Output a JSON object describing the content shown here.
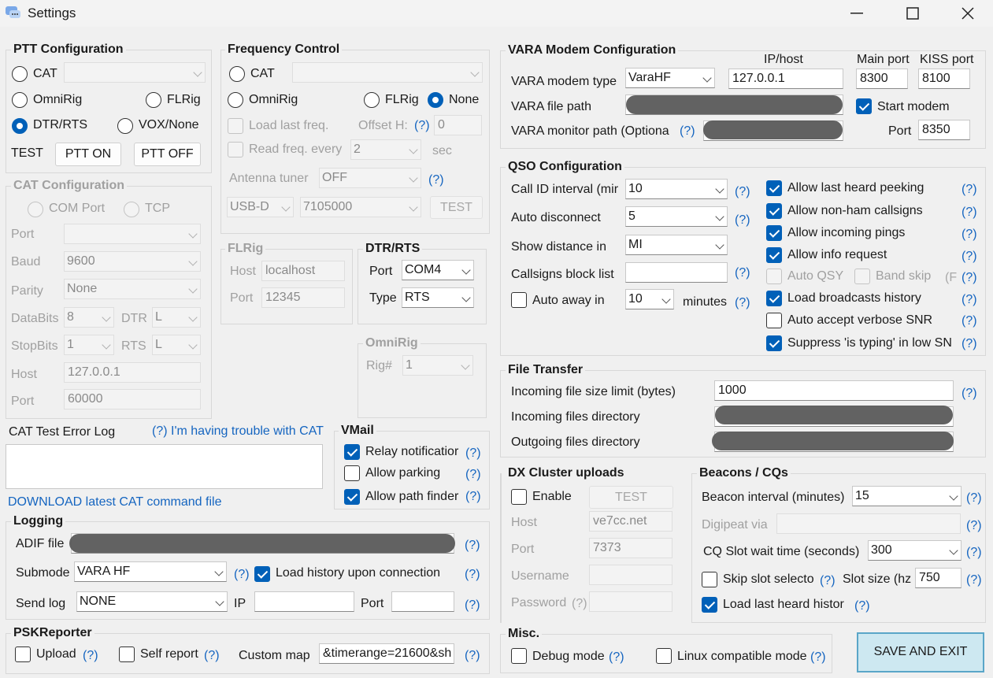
{
  "window": {
    "title": "Settings",
    "minimize": "—",
    "maximize": "☐",
    "close": "✕"
  },
  "ptt": {
    "title": "PTT Configuration",
    "cat": "CAT",
    "omnirig": "OmniRig",
    "flrig": "FLRig",
    "dtr": "DTR/RTS",
    "vox": "VOX/None",
    "test": "TEST",
    "on": "PTT ON",
    "off": "PTT OFF"
  },
  "cat": {
    "title": "CAT Configuration",
    "com": "COM Port",
    "tcp": "TCP",
    "port": "Port",
    "baud": "Baud",
    "baud_val": "9600",
    "parity": "Parity",
    "parity_val": "None",
    "databits": "DataBits",
    "databits_val": "8",
    "dtr": "DTR",
    "dtr_val": "L",
    "stopbits": "StopBits",
    "stopbits_val": "1",
    "rts": "RTS",
    "rts_val": "L",
    "host": "Host",
    "host_val": "127.0.0.1",
    "port2": "Port",
    "port2_val": "60000"
  },
  "freq": {
    "title": "Frequency Control",
    "cat": "CAT",
    "omnirig": "OmniRig",
    "flrig": "FLRig",
    "none": "None",
    "load": "Load last freq.",
    "offset": "Offset H:",
    "offset_val": "0",
    "read": "Read freq. every",
    "read_val": "2",
    "sec": "sec",
    "tuner": "Antenna tuner",
    "tuner_val": "OFF",
    "mode_val": "USB-D",
    "freq_val": "7105000",
    "test": "TEST",
    "help": "(?)"
  },
  "flrig": {
    "title": "FLRig",
    "host": "Host",
    "host_val": "localhost",
    "port": "Port",
    "port_val": "12345"
  },
  "dtr": {
    "title": "DTR/RTS",
    "port": "Port",
    "port_val": "COM4",
    "type": "Type",
    "type_val": "RTS"
  },
  "omni": {
    "title": "OmniRig",
    "rig": "Rig#",
    "rig_val": "1"
  },
  "errlog": {
    "title": "CAT Test Error Log",
    "trouble": "(?) I'm having trouble with CAT",
    "download": "DOWNLOAD latest CAT command file"
  },
  "vmail": {
    "title": "VMail",
    "relay": "Relay notificatior",
    "parking": "Allow parking",
    "path": "Allow path finder",
    "help": "(?)"
  },
  "logging": {
    "title": "Logging",
    "adif": "ADIF file",
    "submode": "Submode",
    "submode_val": "VARA HF",
    "loadhist": "Load history upon connection",
    "send": "Send log",
    "send_val": "NONE",
    "ip": "IP",
    "port": "Port",
    "help": "(?)"
  },
  "psk": {
    "title": "PSKReporter",
    "upload": "Upload",
    "self": "Self report",
    "map": "Custom map",
    "map_val": "&timerange=21600&sh",
    "help": "(?)"
  },
  "vara": {
    "title": "VARA Modem Configuration",
    "iphost": "IP/host",
    "mainport": "Main port",
    "kissport": "KISS port",
    "type": "VARA modem type",
    "type_val": "VaraHF",
    "ip_val": "127.0.0.1",
    "main_val": "8300",
    "kiss_val": "8100",
    "file": "VARA file path",
    "start": "Start modem",
    "monitor": "VARA monitor path (Optiona",
    "port": "Port",
    "port_val": "8350",
    "help": "(?)"
  },
  "qso": {
    "title": "QSO Configuration",
    "callid": "Call ID interval (mir",
    "callid_val": "10",
    "auto": "Auto disconnect",
    "auto_val": "5",
    "dist": "Show distance in",
    "dist_val": "MI",
    "block": "Callsigns block list",
    "away": "Auto away in",
    "away_val": "10",
    "minutes": "minutes",
    "peek": "Allow last heard peeking",
    "nonham": "Allow non-ham callsigns",
    "pings": "Allow incoming pings",
    "info": "Allow info request",
    "autoqsy": "Auto QSY",
    "band": "Band skip",
    "bandf": "(F",
    "bcast": "Load broadcasts history",
    "verbose": "Auto accept verbose SNR",
    "typing": "Suppress 'is typing' in low SN",
    "help": "(?)"
  },
  "ft": {
    "title": "File Transfer",
    "limit": "Incoming file size limit (bytes)",
    "limit_val": "1000",
    "indir": "Incoming files directory",
    "outdir": "Outgoing files directory",
    "help": "(?)"
  },
  "dx": {
    "title": "DX Cluster uploads",
    "enable": "Enable",
    "test": "TEST",
    "host": "Host",
    "host_val": "ve7cc.net",
    "port": "Port",
    "port_val": "7373",
    "user": "Username",
    "pass": "Password",
    "passh": "(?)"
  },
  "beacon": {
    "title": "Beacons / CQs",
    "interval": "Beacon interval (minutes)",
    "interval_val": "15",
    "digi": "Digipeat via",
    "cqslot": "CQ Slot wait time (seconds)",
    "cqslot_val": "300",
    "skip": "Skip slot selecto",
    "slot": "Slot size (hz",
    "slot_val": "750",
    "lastheard": "Load last heard histor",
    "help": "(?)"
  },
  "misc": {
    "title": "Misc.",
    "debug": "Debug mode",
    "linux": "Linux compatible mode",
    "help": "(?)"
  },
  "save": "SAVE AND EXIT"
}
